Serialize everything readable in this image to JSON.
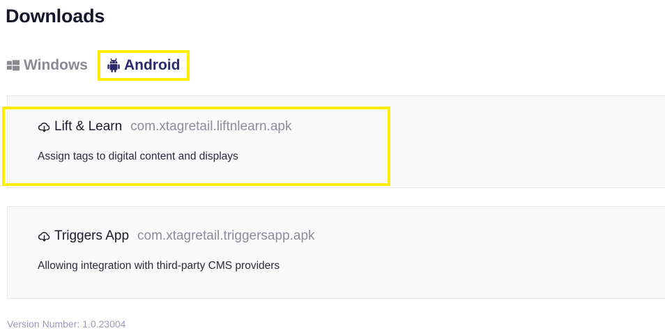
{
  "page": {
    "title": "Downloads"
  },
  "tabs": [
    {
      "label": "Windows",
      "icon": "windows-icon",
      "active": false
    },
    {
      "label": "Android",
      "icon": "android-icon",
      "active": true
    }
  ],
  "apps": [
    {
      "name": "Lift & Learn",
      "file": "com.xtagretail.liftnlearn.apk",
      "description": "Assign tags to digital content and displays",
      "icon": "cloud-download-icon",
      "highlighted": true
    },
    {
      "name": "Triggers App",
      "file": "com.xtagretail.triggersapp.apk",
      "description": "Allowing integration with third-party CMS providers",
      "icon": "cloud-download-icon",
      "highlighted": false
    }
  ],
  "footer": {
    "version": "Version Number: 1.0.23004"
  },
  "colors": {
    "highlight": "#ffee00",
    "active_tab_text": "#2b2a6e",
    "inactive_tab_text": "#8a8a93",
    "version_text": "#9a9ab8"
  }
}
